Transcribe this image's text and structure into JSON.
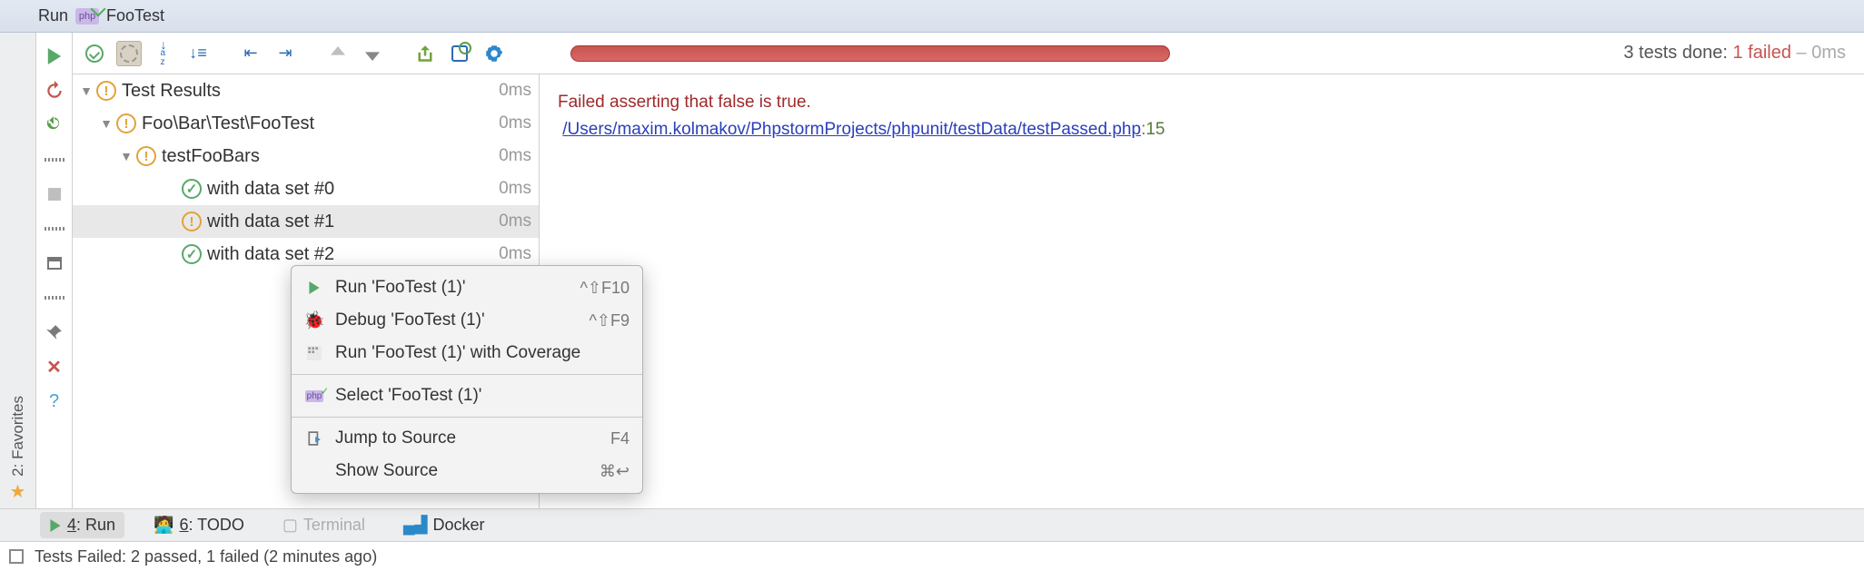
{
  "header": {
    "run_label": "Run",
    "config_name": "FooTest",
    "php_badge": "php"
  },
  "summary": {
    "done": "3 tests done:",
    "failed": "1 failed",
    "time": "– 0ms"
  },
  "tree": [
    {
      "level": 0,
      "status": "warn",
      "name": "Test Results",
      "dur": "0ms",
      "expanded": true
    },
    {
      "level": 1,
      "status": "warn",
      "name": "Foo\\Bar\\Test\\FooTest",
      "dur": "0ms",
      "expanded": true
    },
    {
      "level": 2,
      "status": "warn",
      "name": "testFooBars",
      "dur": "0ms",
      "expanded": true
    },
    {
      "level": 3,
      "status": "pass",
      "name": "with data set #0",
      "dur": "0ms"
    },
    {
      "level": 3,
      "status": "warn",
      "name": "with data set #1",
      "dur": "0ms",
      "selected": true
    },
    {
      "level": 3,
      "status": "pass",
      "name": "with data set #2",
      "dur": "0ms"
    }
  ],
  "output": {
    "message": "Failed asserting that false is true.",
    "link_path": "/Users/maxim.kolmakov/PhpstormProjects/phpunit/testData/testPassed.php",
    "line": ":15"
  },
  "context_menu": {
    "run": "Run 'FooTest (1)'",
    "run_sc": "^⇧F10",
    "debug": "Debug 'FooTest (1)'",
    "debug_sc": "^⇧F9",
    "coverage": "Run 'FooTest (1)' with Coverage",
    "select": "Select 'FooTest (1)'",
    "jump": "Jump to Source",
    "jump_sc": "F4",
    "show_src": "Show Source",
    "show_sc": "⌘↩"
  },
  "tool_tabs": {
    "run": "4: Run",
    "todo": "6: TODO",
    "docker": "Docker",
    "terminal": "Terminal"
  },
  "sidebar": {
    "favorites": "2: Favorites"
  },
  "status": "Tests Failed: 2 passed, 1 failed (2 minutes ago)"
}
